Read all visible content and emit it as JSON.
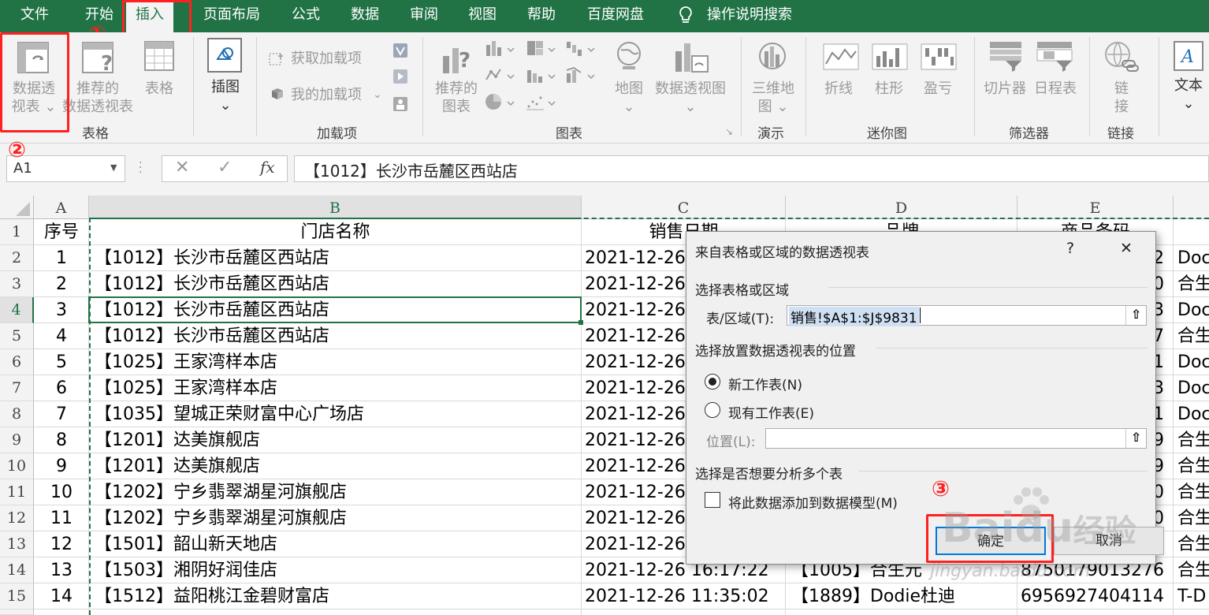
{
  "menu": {
    "tabs": [
      "文件",
      "开始",
      "插入",
      "页面布局",
      "公式",
      "数据",
      "审阅",
      "视图",
      "帮助",
      "百度网盘"
    ],
    "search": "操作说明搜索"
  },
  "ribbon": {
    "table_group": {
      "pivot": [
        "数据透",
        "视表"
      ],
      "recommended": [
        "推荐的",
        "数据透视表"
      ],
      "table": "表格",
      "label": "表格"
    },
    "illus": {
      "label": [
        "插图"
      ]
    },
    "addins": {
      "get": "获取加载项",
      "mine": "我的加载项",
      "label": "加载项"
    },
    "charts": {
      "recommended": [
        "推荐的",
        "图表"
      ],
      "map": "地图",
      "pivotchart": "数据透视图",
      "label": "图表"
    },
    "tours": {
      "map3d": [
        "三维地",
        "图"
      ],
      "label": "演示"
    },
    "sparklines": {
      "line": "折线",
      "column": "柱形",
      "winloss": "盈亏",
      "label": "迷你图"
    },
    "filters": {
      "slicer": "切片器",
      "timeline": "日程表",
      "label": "筛选器"
    },
    "links": {
      "link": [
        "链",
        "接"
      ],
      "label": "链接"
    },
    "text": {
      "label": "文本"
    }
  },
  "annotations": {
    "c1": "①",
    "c2": "②",
    "c3": "③"
  },
  "formula": {
    "name_box": "A1",
    "fx": "fx",
    "content": "【1012】长沙市岳麓区西站店"
  },
  "columns": [
    "A",
    "B",
    "C",
    "D",
    "E"
  ],
  "header_row": {
    "a": "序号",
    "b": "门店名称",
    "c": "销售日期",
    "d": "品牌",
    "e": "商品条码"
  },
  "rows": [
    {
      "n": "2",
      "a": "1",
      "b": "【1012】长沙市岳麓区西站店",
      "c": "2021-12-26",
      "e": "2",
      "f": "Doc"
    },
    {
      "n": "3",
      "a": "2",
      "b": "【1012】长沙市岳麓区西站店",
      "c": "2021-12-26",
      "e": "0",
      "f": "合生"
    },
    {
      "n": "4",
      "a": "3",
      "b": "【1012】长沙市岳麓区西站店",
      "c": "2021-12-26",
      "e": "3",
      "f": "Doc"
    },
    {
      "n": "5",
      "a": "4",
      "b": "【1012】长沙市岳麓区西站店",
      "c": "2021-12-26",
      "e": "7",
      "f": "合生"
    },
    {
      "n": "6",
      "a": "5",
      "b": "【1025】王家湾样本店",
      "c": "2021-12-26",
      "e": "1",
      "f": "Doc"
    },
    {
      "n": "7",
      "a": "6",
      "b": "【1025】王家湾样本店",
      "c": "2021-12-26",
      "e": "3",
      "f": "Doc"
    },
    {
      "n": "8",
      "a": "7",
      "b": "【1035】望城正荣财富中心广场店",
      "c": "2021-12-26",
      "e": "1",
      "f": "Doc"
    },
    {
      "n": "9",
      "a": "8",
      "b": "【1201】达美旗舰店",
      "c": "2021-12-26",
      "e": "9",
      "f": "合生"
    },
    {
      "n": "10",
      "a": "9",
      "b": "【1201】达美旗舰店",
      "c": "2021-12-26",
      "e": "9",
      "f": "合生"
    },
    {
      "n": "11",
      "a": "10",
      "b": "【1202】宁乡翡翠湖星河旗舰店",
      "c": "2021-12-26",
      "e": "0",
      "f": "合生"
    },
    {
      "n": "12",
      "a": "11",
      "b": "【1202】宁乡翡翠湖星河旗舰店",
      "c": "2021-12-26",
      "e": "0",
      "f": "合生"
    },
    {
      "n": "13",
      "a": "12",
      "b": "【1501】韶山新天地店",
      "c": "2021-12-26",
      "e": "4",
      "f": "合生"
    },
    {
      "n": "14",
      "a": "13",
      "b": "【1503】湘阴好润佳店",
      "c": "2021-12-26 16:17:22",
      "d": "【1005】合生元",
      "e": "8750179013276",
      "f": "合生"
    },
    {
      "n": "15",
      "a": "14",
      "b": "【1512】益阳桃江金碧财富店",
      "c": "2021-12-26 11:35:02",
      "d": "【1889】Dodie杜迪",
      "e": "6956927404114",
      "f": "T-D"
    }
  ],
  "dialog": {
    "title": "来自表格或区域的数据透视表",
    "help": "?",
    "close": "✕",
    "sec1": "选择表格或区域",
    "range_label": "表/区域(T):",
    "range_value": "销售!$A$1:$J$9831",
    "sec2": "选择放置数据透视表的位置",
    "opt_new": "新工作表(N)",
    "opt_existing": "现有工作表(E)",
    "location_label": "位置(L):",
    "sec3": "选择是否想要分析多个表",
    "checkbox_label": "将此数据添加到数据模型(M)",
    "ok": "确定",
    "cancel": "取消"
  },
  "watermark": {
    "brand": "Baidu",
    "jingyan": "经验",
    "url": "jingyan.baidu.com"
  }
}
